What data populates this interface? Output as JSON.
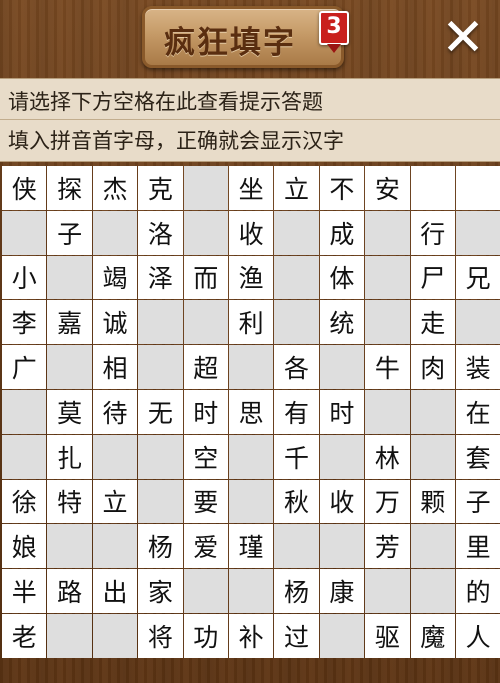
{
  "header": {
    "title": "疯狂填字",
    "level": "3",
    "close_label": "✕"
  },
  "hints": {
    "line1": "请选择下方空格在此查看提示答题",
    "line2": "填入拼音首字母，正确就会显示汉字"
  },
  "grid": {
    "rows": [
      [
        "侠",
        "探",
        "杰",
        "克",
        "#",
        "坐",
        "立",
        "不",
        "安",
        "",
        ""
      ],
      [
        "#",
        "子",
        "#",
        "洛",
        "#",
        "收",
        "#",
        "成",
        "#",
        "行",
        "#"
      ],
      [
        "小",
        "#",
        "竭",
        "泽",
        "而",
        "渔",
        "#",
        "体",
        "#",
        "尸",
        "兄"
      ],
      [
        "李",
        "嘉",
        "诚",
        "#",
        "#",
        "利",
        "#",
        "统",
        "#",
        "走",
        "#"
      ],
      [
        "广",
        "#",
        "相",
        "#",
        "超",
        "#",
        "各",
        "#",
        "牛",
        "肉",
        "装"
      ],
      [
        "#",
        "莫",
        "待",
        "无",
        "时",
        "思",
        "有",
        "时",
        "#",
        "#",
        "在"
      ],
      [
        "#",
        "扎",
        "#",
        "#",
        "空",
        "#",
        "千",
        "#",
        "林",
        "#",
        "套"
      ],
      [
        "徐",
        "特",
        "立",
        "#",
        "要",
        "#",
        "秋",
        "收",
        "万",
        "颗",
        "子"
      ],
      [
        "娘",
        "#",
        "#",
        "杨",
        "爱",
        "瑾",
        "#",
        "#",
        "芳",
        "#",
        "里"
      ],
      [
        "半",
        "路",
        "出",
        "家",
        "#",
        "#",
        "杨",
        "康",
        "#",
        "#",
        "的"
      ],
      [
        "老",
        "#",
        "#",
        "将",
        "功",
        "补",
        "过",
        "#",
        "驱",
        "魔",
        "人"
      ]
    ]
  }
}
